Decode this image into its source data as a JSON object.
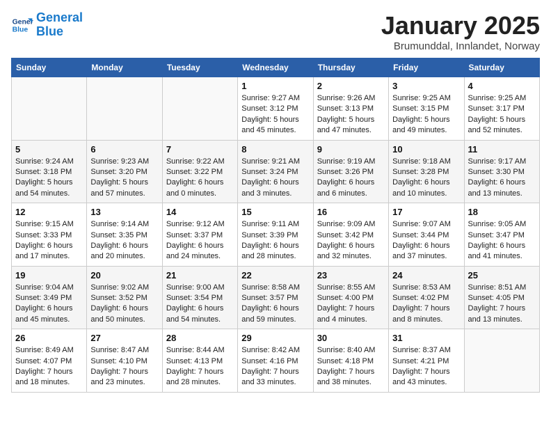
{
  "header": {
    "logo_line1": "General",
    "logo_line2": "Blue",
    "title": "January 2025",
    "location": "Brumunddal, Innlandet, Norway"
  },
  "weekdays": [
    "Sunday",
    "Monday",
    "Tuesday",
    "Wednesday",
    "Thursday",
    "Friday",
    "Saturday"
  ],
  "weeks": [
    [
      {
        "day": "",
        "info": ""
      },
      {
        "day": "",
        "info": ""
      },
      {
        "day": "",
        "info": ""
      },
      {
        "day": "1",
        "info": "Sunrise: 9:27 AM\nSunset: 3:12 PM\nDaylight: 5 hours\nand 45 minutes."
      },
      {
        "day": "2",
        "info": "Sunrise: 9:26 AM\nSunset: 3:13 PM\nDaylight: 5 hours\nand 47 minutes."
      },
      {
        "day": "3",
        "info": "Sunrise: 9:25 AM\nSunset: 3:15 PM\nDaylight: 5 hours\nand 49 minutes."
      },
      {
        "day": "4",
        "info": "Sunrise: 9:25 AM\nSunset: 3:17 PM\nDaylight: 5 hours\nand 52 minutes."
      }
    ],
    [
      {
        "day": "5",
        "info": "Sunrise: 9:24 AM\nSunset: 3:18 PM\nDaylight: 5 hours\nand 54 minutes."
      },
      {
        "day": "6",
        "info": "Sunrise: 9:23 AM\nSunset: 3:20 PM\nDaylight: 5 hours\nand 57 minutes."
      },
      {
        "day": "7",
        "info": "Sunrise: 9:22 AM\nSunset: 3:22 PM\nDaylight: 6 hours\nand 0 minutes."
      },
      {
        "day": "8",
        "info": "Sunrise: 9:21 AM\nSunset: 3:24 PM\nDaylight: 6 hours\nand 3 minutes."
      },
      {
        "day": "9",
        "info": "Sunrise: 9:19 AM\nSunset: 3:26 PM\nDaylight: 6 hours\nand 6 minutes."
      },
      {
        "day": "10",
        "info": "Sunrise: 9:18 AM\nSunset: 3:28 PM\nDaylight: 6 hours\nand 10 minutes."
      },
      {
        "day": "11",
        "info": "Sunrise: 9:17 AM\nSunset: 3:30 PM\nDaylight: 6 hours\nand 13 minutes."
      }
    ],
    [
      {
        "day": "12",
        "info": "Sunrise: 9:15 AM\nSunset: 3:33 PM\nDaylight: 6 hours\nand 17 minutes."
      },
      {
        "day": "13",
        "info": "Sunrise: 9:14 AM\nSunset: 3:35 PM\nDaylight: 6 hours\nand 20 minutes."
      },
      {
        "day": "14",
        "info": "Sunrise: 9:12 AM\nSunset: 3:37 PM\nDaylight: 6 hours\nand 24 minutes."
      },
      {
        "day": "15",
        "info": "Sunrise: 9:11 AM\nSunset: 3:39 PM\nDaylight: 6 hours\nand 28 minutes."
      },
      {
        "day": "16",
        "info": "Sunrise: 9:09 AM\nSunset: 3:42 PM\nDaylight: 6 hours\nand 32 minutes."
      },
      {
        "day": "17",
        "info": "Sunrise: 9:07 AM\nSunset: 3:44 PM\nDaylight: 6 hours\nand 37 minutes."
      },
      {
        "day": "18",
        "info": "Sunrise: 9:05 AM\nSunset: 3:47 PM\nDaylight: 6 hours\nand 41 minutes."
      }
    ],
    [
      {
        "day": "19",
        "info": "Sunrise: 9:04 AM\nSunset: 3:49 PM\nDaylight: 6 hours\nand 45 minutes."
      },
      {
        "day": "20",
        "info": "Sunrise: 9:02 AM\nSunset: 3:52 PM\nDaylight: 6 hours\nand 50 minutes."
      },
      {
        "day": "21",
        "info": "Sunrise: 9:00 AM\nSunset: 3:54 PM\nDaylight: 6 hours\nand 54 minutes."
      },
      {
        "day": "22",
        "info": "Sunrise: 8:58 AM\nSunset: 3:57 PM\nDaylight: 6 hours\nand 59 minutes."
      },
      {
        "day": "23",
        "info": "Sunrise: 8:55 AM\nSunset: 4:00 PM\nDaylight: 7 hours\nand 4 minutes."
      },
      {
        "day": "24",
        "info": "Sunrise: 8:53 AM\nSunset: 4:02 PM\nDaylight: 7 hours\nand 8 minutes."
      },
      {
        "day": "25",
        "info": "Sunrise: 8:51 AM\nSunset: 4:05 PM\nDaylight: 7 hours\nand 13 minutes."
      }
    ],
    [
      {
        "day": "26",
        "info": "Sunrise: 8:49 AM\nSunset: 4:07 PM\nDaylight: 7 hours\nand 18 minutes."
      },
      {
        "day": "27",
        "info": "Sunrise: 8:47 AM\nSunset: 4:10 PM\nDaylight: 7 hours\nand 23 minutes."
      },
      {
        "day": "28",
        "info": "Sunrise: 8:44 AM\nSunset: 4:13 PM\nDaylight: 7 hours\nand 28 minutes."
      },
      {
        "day": "29",
        "info": "Sunrise: 8:42 AM\nSunset: 4:16 PM\nDaylight: 7 hours\nand 33 minutes."
      },
      {
        "day": "30",
        "info": "Sunrise: 8:40 AM\nSunset: 4:18 PM\nDaylight: 7 hours\nand 38 minutes."
      },
      {
        "day": "31",
        "info": "Sunrise: 8:37 AM\nSunset: 4:21 PM\nDaylight: 7 hours\nand 43 minutes."
      },
      {
        "day": "",
        "info": ""
      }
    ]
  ]
}
